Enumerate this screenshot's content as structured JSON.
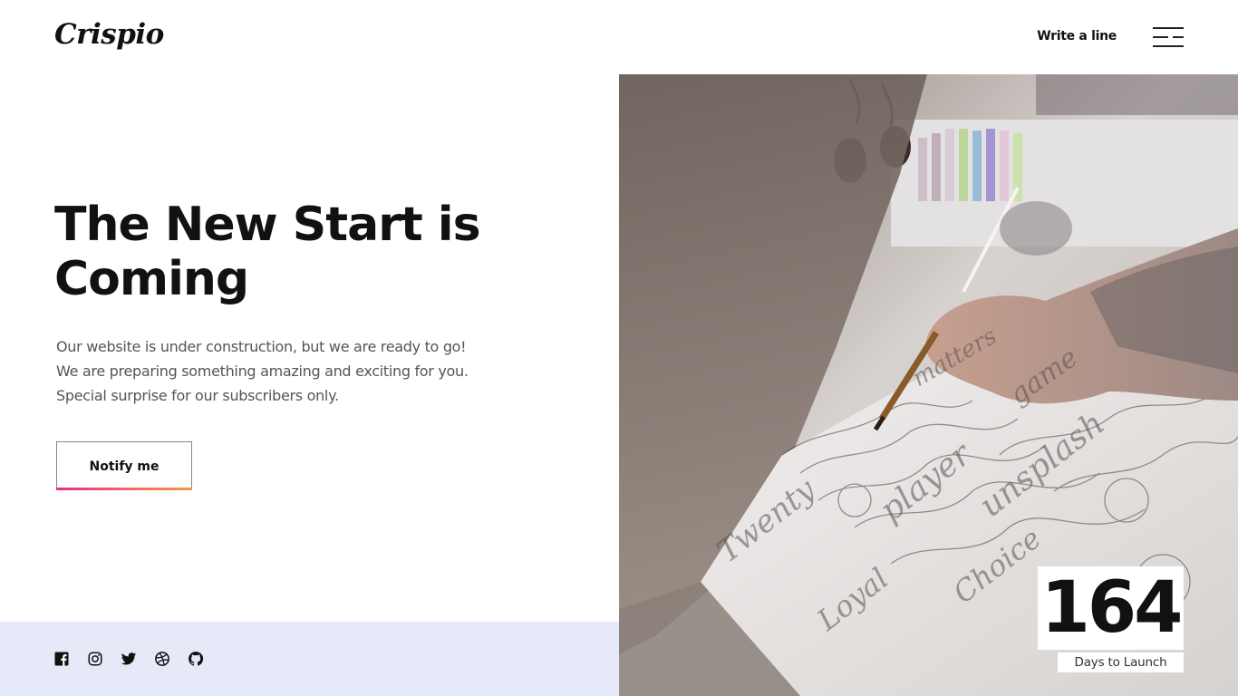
{
  "brand": {
    "logo_text": "Crispio"
  },
  "header": {
    "write_link": "Write a line",
    "menu_icon": "menu-icon"
  },
  "hero": {
    "title": "The New Start is Coming",
    "description_lines": [
      "Our website is under construction, but we are ready to go!",
      "We are preparing something amazing and exciting for you.",
      "Special surprise for our subscribers only."
    ],
    "notify_label": "Notify me"
  },
  "countdown": {
    "value": "164",
    "label": "Days to Launch"
  },
  "socials": [
    {
      "icon": "facebook-icon"
    },
    {
      "icon": "instagram-icon"
    },
    {
      "icon": "twitter-icon"
    },
    {
      "icon": "dribbble-icon"
    },
    {
      "icon": "github-icon"
    }
  ],
  "photo": {
    "script_words": [
      "Twenty",
      "Loyal",
      "player",
      "matters",
      "game",
      "unsplash",
      "Choice"
    ]
  },
  "colors": {
    "accent_gradient_start": "#ec2c8c",
    "accent_gradient_end": "#f2994a",
    "footer_bg": "#e6e9f7",
    "text_dark": "#111111"
  }
}
